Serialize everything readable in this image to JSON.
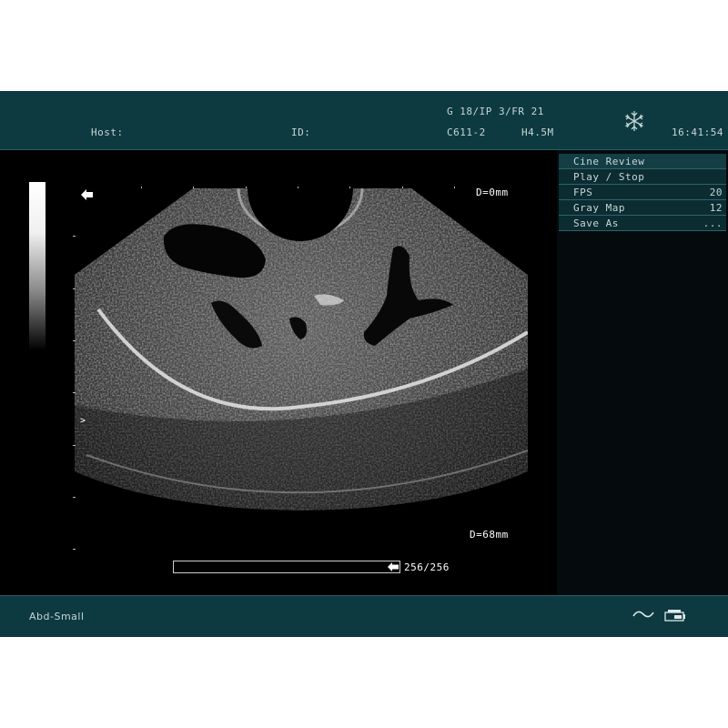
{
  "header": {
    "host_label": "Host:",
    "id_label": "ID:",
    "params": "G 18/IP 3/FR 21",
    "probe": "C611-2",
    "freq": "H4.5M",
    "time": "16:41:54",
    "freeze_icon": "snowflake-icon"
  },
  "image": {
    "depth_top": "D=0mm",
    "depth_bottom": "D=68mm",
    "frame_counter": "256/256",
    "focus_marker": ">"
  },
  "menu": {
    "title": "Cine Review",
    "items": [
      {
        "label": "Play / Stop",
        "value": ""
      },
      {
        "label": "FPS",
        "value": "20"
      },
      {
        "label": "Gray Map",
        "value": "12"
      },
      {
        "label": "Save As",
        "value": "..."
      }
    ]
  },
  "footer": {
    "preset": "Abd-Small",
    "wave_icon": "tilde-wave-icon",
    "printer_icon": "printer-icon"
  },
  "colors": {
    "bar": "#0d3a40",
    "text": "#c8d6d8",
    "panel_border": "#2f6268"
  }
}
